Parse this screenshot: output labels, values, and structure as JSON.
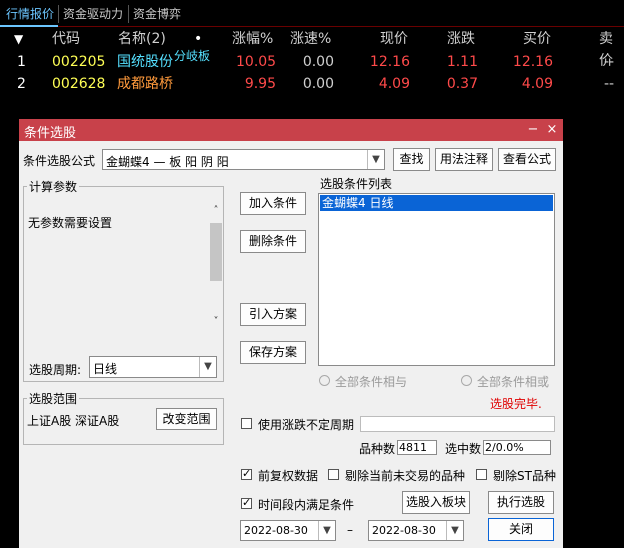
{
  "tabs": [
    {
      "label": "行情报价",
      "active": true
    },
    {
      "label": "资金驱动力",
      "active": false
    },
    {
      "label": "资金博弈",
      "active": false
    }
  ],
  "quote_table": {
    "sort_marker": "▼",
    "dot": "•",
    "headers": [
      "代码",
      "名称(2)",
      "涨幅%",
      "涨速%",
      "现价",
      "涨跌",
      "买价",
      "卖价"
    ],
    "rows": [
      {
        "index": "1",
        "code": "002205",
        "name": "国统股份",
        "tag": "分岐板",
        "change_pct": "10.05",
        "speed": "0.00",
        "price": "12.16",
        "change": "1.11",
        "bid": "12.16",
        "ask": "--"
      },
      {
        "index": "2",
        "code": "002628",
        "name": "成都路桥",
        "tag": "",
        "change_pct": "9.95",
        "speed": "0.00",
        "price": "4.09",
        "change": "0.37",
        "bid": "4.09",
        "ask": "--"
      }
    ],
    "colors": {
      "code": "#ffff55",
      "name1": "#55e0ff",
      "name2": "#ff9a3c",
      "up": "#ff4a4a",
      "tag": "#55e0ff"
    }
  },
  "dialog": {
    "title": "条件选股",
    "minimize": "−",
    "close": "×",
    "formula_label": "条件选股公式",
    "formula_value": "金蝴蝶4    — 板 阳 阴 阳",
    "find_button": "查找",
    "usage_button": "用法注释",
    "view_formula_button": "查看公式",
    "params_group": "计算参数",
    "params_text": "无参数需要设置",
    "period_label": "选股周期:",
    "period_value": "日线",
    "add_condition": "加入条件",
    "delete_condition": "删除条件",
    "import_plan": "引入方案",
    "save_plan": "保存方案",
    "condition_list_label": "选股条件列表",
    "condition_list": [
      "金蝴蝶4   日线"
    ],
    "radio_and": "全部条件相与",
    "radio_or": "全部条件相或",
    "status": "选股完毕.",
    "scope_group": "选股范围",
    "scope_text": "上证A股 深证A股",
    "change_scope": "改变范围",
    "use_variable_period": "使用涨跌不定周期",
    "stock_count_label": "品种数",
    "stock_count": "4811",
    "selected_label": "选中数",
    "selected_count": "2/0.0%",
    "pre_adjust": "前复权数据",
    "exclude_untraded": "剔除当前未交易的品种",
    "exclude_st": "剔除ST品种",
    "time_range": "时间段内满足条件",
    "select_to_block": "选股入板块",
    "execute": "执行选股",
    "date_from": "2022-08-30",
    "date_to": "2022-08-30",
    "date_sep": "–",
    "close_button": "关闭",
    "checks": {
      "use_variable_period": false,
      "pre_adjust": true,
      "exclude_untraded": false,
      "exclude_st": false,
      "time_range": true
    }
  }
}
